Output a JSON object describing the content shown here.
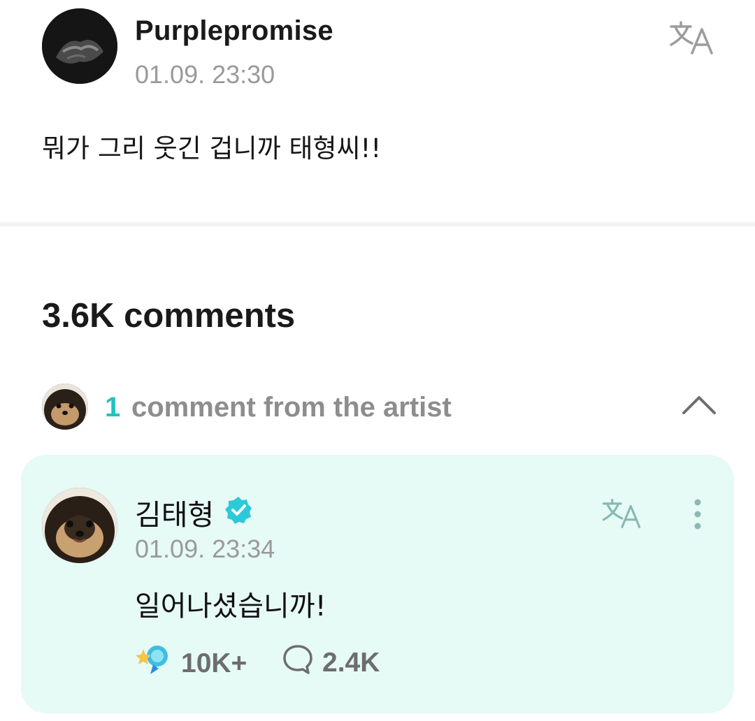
{
  "post": {
    "username": "Purplepromise",
    "timestamp": "01.09. 23:30",
    "text": "뭐가 그리 웃긴 겁니까 태형씨!!",
    "translate_icon": "translate-icon"
  },
  "comments": {
    "count_label": "3.6K comments",
    "artist_section": {
      "count": "1",
      "label": "comment from the artist",
      "collapse_icon": "chevron-up-icon"
    },
    "artist_comment": {
      "name": "김태형",
      "verified_icon": "verified-badge-icon",
      "timestamp": "01.09. 23:34",
      "text": "일어나셨습니까!",
      "likes": "10K+",
      "replies": "2.4K",
      "more_icon": "more-vertical-icon"
    }
  },
  "colors": {
    "accent": "#1fc3bd",
    "card_background": "#e6faf6",
    "muted_text": "#9a9a9a"
  }
}
